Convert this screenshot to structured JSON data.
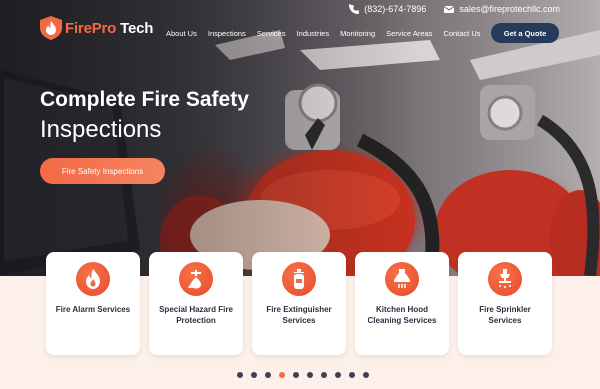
{
  "contact": {
    "phone": "(832)-674-7896",
    "email": "sales@fireprotechllc.com"
  },
  "logo": {
    "part1": "Fire",
    "part2": "Pro",
    "part3": " Tech"
  },
  "nav": [
    "About Us",
    "Inspections",
    "Services",
    "Industries",
    "Monitoring",
    "Service Areas",
    "Contact Us"
  ],
  "quote_button": "Get a Quote",
  "hero": {
    "line1": "Complete Fire Safety",
    "line2": "Inspections",
    "cta": "Fire Safety Inspections"
  },
  "cards": [
    {
      "label": "Fire Alarm Services",
      "icon": "flame-icon"
    },
    {
      "label": "Special Hazard Fire Protection",
      "icon": "hazard-icon"
    },
    {
      "label": "Fire Extinguisher Services",
      "icon": "extinguisher-icon"
    },
    {
      "label": "Kitchen Hood Cleaning Services",
      "icon": "kitchen-hood-icon"
    },
    {
      "label": "Fire Sprinkler Services",
      "icon": "sprinkler-icon"
    }
  ],
  "carousel": {
    "total": 10,
    "active_index": 3
  },
  "colors": {
    "accent": "#f26a45",
    "navy": "#263a5c",
    "card_text": "#2a2f3d"
  }
}
